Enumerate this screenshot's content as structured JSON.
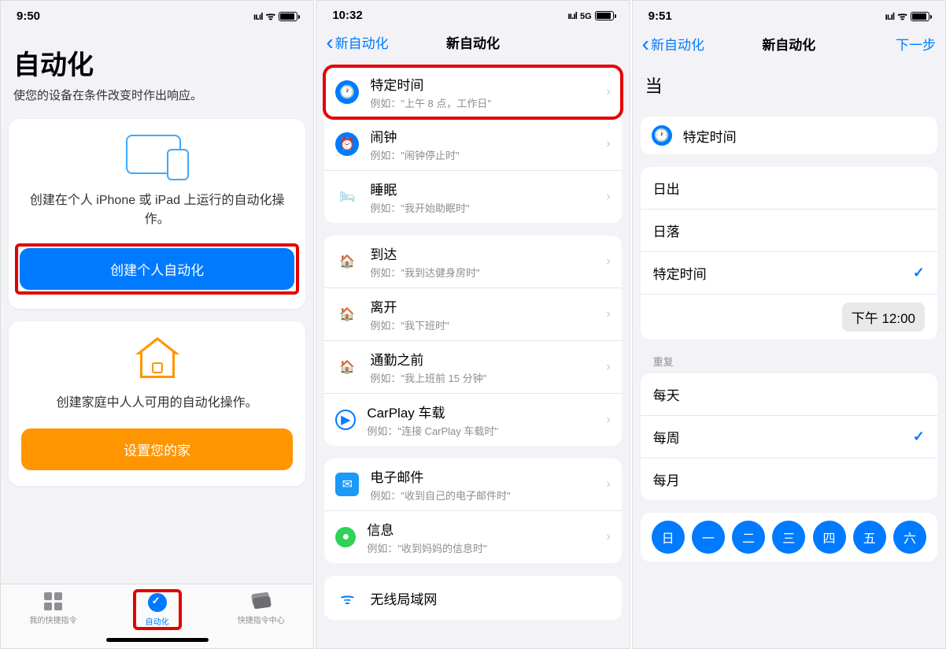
{
  "screen1": {
    "time": "9:50",
    "title": "自动化",
    "subtitle": "使您的设备在条件改变时作出响应。",
    "personal_text": "创建在个人 iPhone 或 iPad 上运行的自动化操作。",
    "btn_personal": "创建个人自动化",
    "home_text": "创建家庭中人人可用的自动化操作。",
    "btn_home": "设置您的家",
    "tabs": {
      "shortcuts": "我的快捷指令",
      "automation": "自动化",
      "gallery": "快捷指令中心"
    }
  },
  "screen2": {
    "time": "10:32",
    "back": "新自动化",
    "title": "新自动化",
    "rows": [
      {
        "title": "特定时间",
        "sub": "例如：\"上午 8 点，工作日\""
      },
      {
        "title": "闹钟",
        "sub": "例如：\"闹钟停止时\""
      },
      {
        "title": "睡眠",
        "sub": "例如：\"我开始助眠时\""
      },
      {
        "title": "到达",
        "sub": "例如：\"我到达健身房时\""
      },
      {
        "title": "离开",
        "sub": "例如：\"我下班时\""
      },
      {
        "title": "通勤之前",
        "sub": "例如：\"我上班前 15 分钟\""
      },
      {
        "title": "CarPlay 车载",
        "sub": "例如：\"连接 CarPlay 车载时\""
      },
      {
        "title": "电子邮件",
        "sub": "例如：\"收到自己的电子邮件时\""
      },
      {
        "title": "信息",
        "sub": "例如：\"收到妈妈的信息时\""
      },
      {
        "title": "无线局域网",
        "sub": ""
      }
    ]
  },
  "screen3": {
    "time": "9:51",
    "back": "新自动化",
    "title": "新自动化",
    "next": "下一步",
    "when_label": "当",
    "selected_trigger": "特定时间",
    "options": {
      "sunrise": "日出",
      "sunset": "日落",
      "specific": "特定时间"
    },
    "time_value": "下午 12:00",
    "repeat_label": "重复",
    "repeat": {
      "daily": "每天",
      "weekly": "每周",
      "monthly": "每月"
    },
    "days": [
      "日",
      "一",
      "二",
      "三",
      "四",
      "五",
      "六"
    ]
  }
}
